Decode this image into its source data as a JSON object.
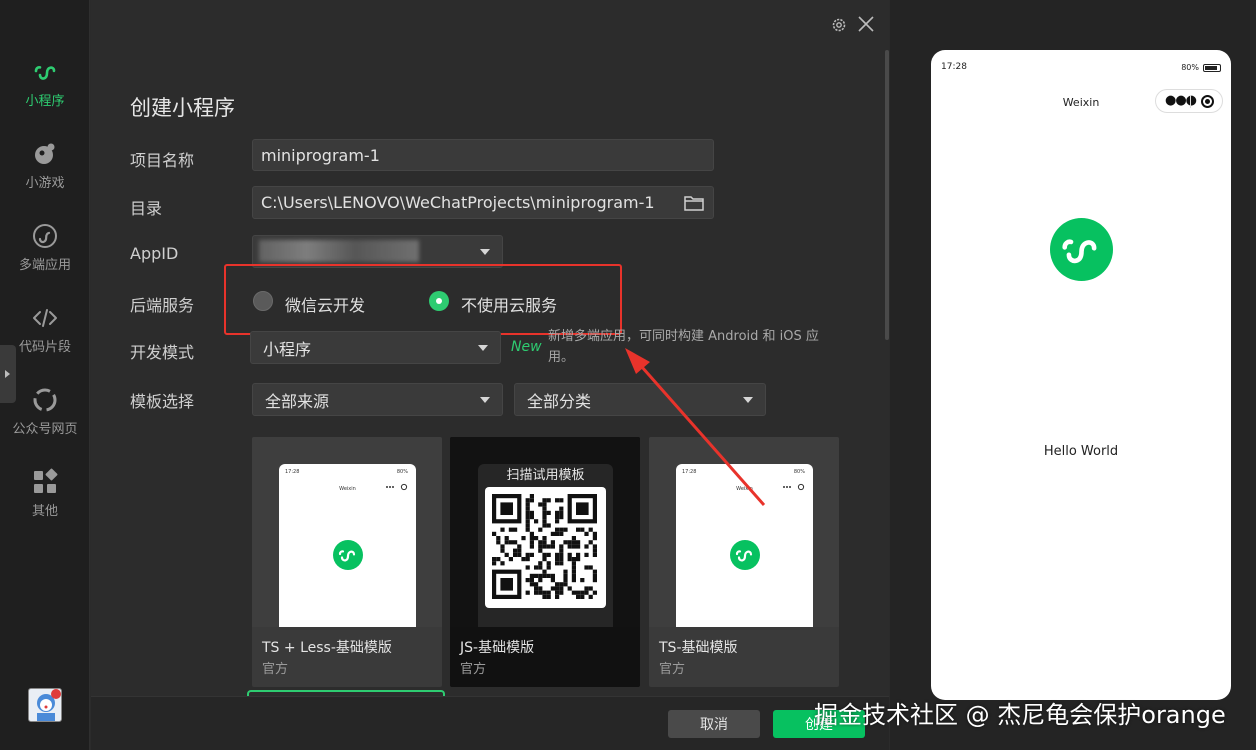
{
  "sidebar": {
    "items": [
      {
        "label": "小程序",
        "icon": "miniprogram-icon",
        "active": true
      },
      {
        "label": "小游戏",
        "icon": "minigame-icon"
      },
      {
        "label": "多端应用",
        "icon": "multi-app-icon"
      },
      {
        "label": "代码片段",
        "icon": "code-icon"
      },
      {
        "label": "公众号网页",
        "icon": "official-account-icon"
      },
      {
        "label": "其他",
        "icon": "grid-icon"
      }
    ]
  },
  "dialog": {
    "title": "创建小程序",
    "fields": {
      "project_name": {
        "label": "项目名称",
        "value": "miniprogram-1"
      },
      "directory": {
        "label": "目录",
        "value": "C:\\Users\\LENOVO\\WeChatProjects\\miniprogram-1"
      },
      "appid": {
        "label": "AppID"
      },
      "backend": {
        "label": "后端服务",
        "options": [
          {
            "label": "微信云开发",
            "selected": false
          },
          {
            "label": "不使用云服务",
            "selected": true
          }
        ]
      },
      "dev_mode": {
        "label": "开发模式",
        "value": "小程序",
        "new_tag": "New",
        "hint": "新增多端应用，可同时构建 Android 和 iOS 应用。"
      },
      "template": {
        "label": "模板选择",
        "source_value": "全部来源",
        "category_value": "全部分类"
      }
    },
    "templates": [
      {
        "name": "TS + Less-基础模版",
        "source": "官方",
        "preview_time": "17:28",
        "preview_battery": "80%",
        "preview_title": "Weixin"
      },
      {
        "name": "JS-基础模版",
        "source": "官方",
        "qr_title": "扫描试用模板"
      },
      {
        "name": "TS-基础模版",
        "source": "官方",
        "preview_time": "17:28",
        "preview_battery": "80%",
        "preview_title": "Weixin"
      }
    ],
    "buttons": {
      "cancel": "取消",
      "create": "创建"
    }
  },
  "preview": {
    "time": "17:28",
    "battery": "80%",
    "title": "Weixin",
    "body": "Hello World"
  },
  "watermark": "掘金技术社区 @ 杰尼龟会保护orange",
  "colors": {
    "accent": "#07c160",
    "highlight": "#e8332b"
  }
}
